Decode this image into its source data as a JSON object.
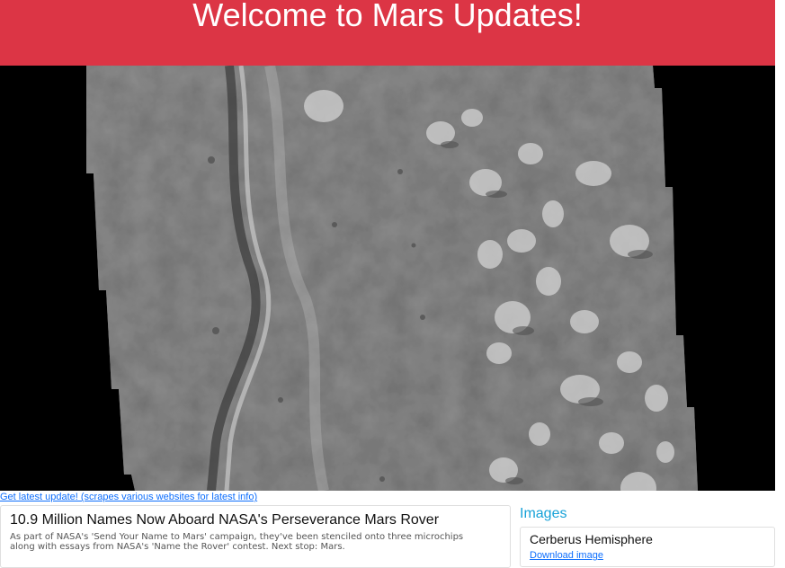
{
  "header": {
    "title": "Welcome to Mars Updates!",
    "background": "#dc3545"
  },
  "hero": {
    "image": "mars-surface-photo"
  },
  "update_link": "Get latest update! (scrapes various websites for latest info)",
  "news": {
    "title": "10.9 Million Names Now Aboard NASA's Perseverance Mars Rover",
    "paragraph_lines": [
      "As part of NASA's 'Send Your Name to Mars' campaign, they've been stenciled onto three microchips",
      "along with essays from NASA's 'Name the Rover' contest. Next stop: Mars."
    ]
  },
  "images": {
    "heading": "Images",
    "items": [
      {
        "title": "Cerberus Hemisphere",
        "link_label": "Download image"
      }
    ]
  },
  "colors": {
    "accent": "#dc3545",
    "link": "#0d6efd",
    "images_heading": "#17a2d8"
  }
}
